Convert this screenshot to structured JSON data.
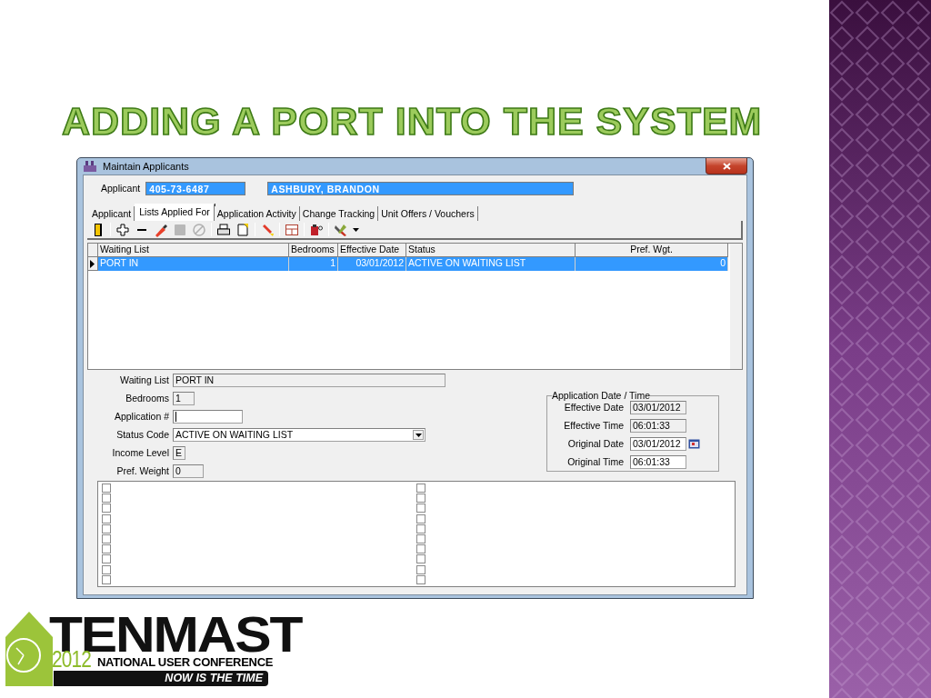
{
  "slide": {
    "title": "ADDING A PORT INTO THE SYSTEM"
  },
  "window": {
    "title": "Maintain Applicants",
    "applicant_label": "Applicant",
    "applicant_id": "405-73-6487",
    "applicant_name": "ASHBURY, BRANDON"
  },
  "tabs": [
    {
      "label": "Applicant",
      "selected": false
    },
    {
      "label": "Lists Applied For",
      "selected": true
    },
    {
      "label": "Application Activity",
      "selected": false
    },
    {
      "label": "Change Tracking",
      "selected": false
    },
    {
      "label": "Unit Offers / Vouchers",
      "selected": false
    }
  ],
  "table": {
    "columns": [
      "Waiting List",
      "Bedrooms",
      "Effective Date",
      "Status",
      "Pref. Wgt."
    ],
    "rows": [
      {
        "selected": true,
        "cells": [
          "PORT IN",
          "1",
          "03/01/2012",
          "ACTIVE ON WAITING LIST",
          "0"
        ]
      }
    ]
  },
  "details": [
    {
      "label": "Waiting List",
      "value": "PORT IN",
      "kind": "readonly"
    },
    {
      "label": "Bedrooms",
      "value": "1",
      "kind": "readonly"
    },
    {
      "label": "Application #",
      "kind": "input"
    },
    {
      "label": "Status Code",
      "value": "ACTIVE ON WAITING LIST",
      "kind": "dropdown"
    },
    {
      "label": "Income Level",
      "value": "E",
      "kind": "readonly"
    },
    {
      "label": "Pref. Weight",
      "value": "0",
      "kind": "readonly"
    }
  ],
  "application_date_time": {
    "title": "Application Date / Time",
    "fields": [
      {
        "label": "Effective Date",
        "value": "03/01/2012",
        "kind": "readonly"
      },
      {
        "label": "Effective Time",
        "value": "06:01:33",
        "kind": "readonly"
      },
      {
        "label": "Original Date",
        "value": "03/01/2012",
        "kind": "date"
      },
      {
        "label": "Original Time",
        "value": "06:01:33",
        "kind": "input"
      }
    ]
  },
  "checkbox_columns": [
    [
      {
        "checked": false
      },
      {
        "checked": false
      },
      {
        "checked": false
      },
      {
        "checked": false
      },
      {
        "checked": false
      },
      {
        "checked": false
      },
      {
        "checked": false
      },
      {
        "checked": false
      },
      {
        "checked": false
      },
      {
        "checked": false
      }
    ],
    [
      {
        "checked": false
      },
      {
        "checked": false
      },
      {
        "checked": false
      },
      {
        "checked": false
      },
      {
        "checked": false
      },
      {
        "checked": false
      },
      {
        "checked": false
      },
      {
        "checked": false
      },
      {
        "checked": false
      },
      {
        "checked": false
      }
    ]
  ],
  "logo": {
    "brand": "TENMAST",
    "year": "2012",
    "subtitle": "NATIONAL USER CONFERENCE",
    "tagline": "NOW IS THE TIME"
  }
}
